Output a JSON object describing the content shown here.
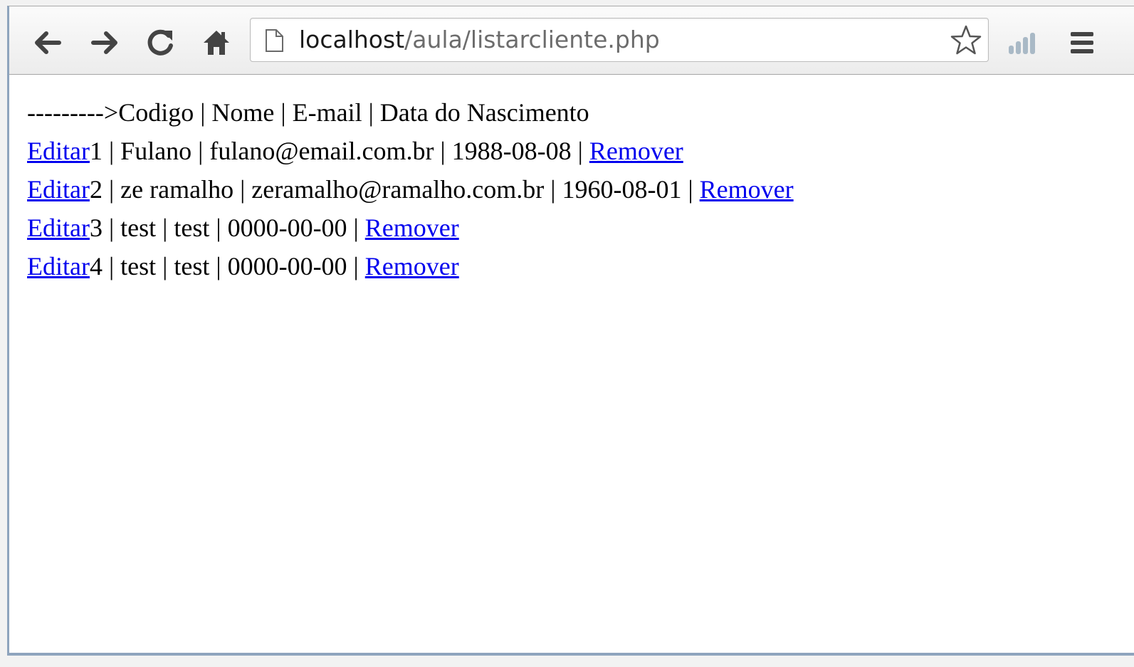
{
  "browser": {
    "url_host": "localhost",
    "url_path": "/aula/listarcliente.php",
    "icons": [
      "back-arrow-icon",
      "forward-arrow-icon",
      "reload-icon",
      "home-icon",
      "page-icon",
      "bookmark-star-icon",
      "signal-bars-icon",
      "menu-icon"
    ]
  },
  "page": {
    "header": "--------->Codigo | Nome | E-mail | Data do Nascimento",
    "rows": [
      {
        "edit_label": "Editar",
        "text": "1 | Fulano | fulano@email.com.br | 1988-08-08 | ",
        "remove_label": "Remover"
      },
      {
        "edit_label": "Editar",
        "text": "2 | ze ramalho | zeramalho@ramalho.com.br | 1960-08-01 | ",
        "remove_label": "Remover"
      },
      {
        "edit_label": "Editar",
        "text": "3 | test | test | 0000-00-00 | ",
        "remove_label": "Remover"
      },
      {
        "edit_label": "Editar",
        "text": "4 | test | test | 0000-00-00 | ",
        "remove_label": "Remover"
      }
    ]
  },
  "colors": {
    "link": "#0000ee",
    "icon_dark": "#444444",
    "signal_icon": "#a9b9c6"
  }
}
